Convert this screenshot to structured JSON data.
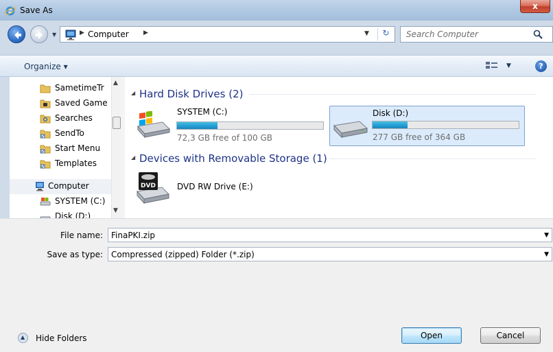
{
  "window": {
    "title": "Save As",
    "close_label": "x"
  },
  "address": {
    "path": "Computer",
    "search_placeholder": "Search Computer"
  },
  "toolbar": {
    "organize_label": "Organize ▾",
    "help_label": "?"
  },
  "nav_pane": {
    "items": [
      {
        "label": "SametimeTr",
        "icon": "folder-icon"
      },
      {
        "label": "Saved Game",
        "icon": "saved-games-icon"
      },
      {
        "label": "Searches",
        "icon": "searches-icon"
      },
      {
        "label": "SendTo",
        "icon": "shortcut-folder-icon"
      },
      {
        "label": "Start Menu",
        "icon": "shortcut-folder-icon"
      },
      {
        "label": "Templates",
        "icon": "shortcut-folder-icon"
      },
      {
        "label": "Computer",
        "icon": "computer-icon"
      },
      {
        "label": "SYSTEM (C:)",
        "icon": "drive-icon"
      },
      {
        "label": "Disk (D:)",
        "icon": "drive-icon"
      }
    ]
  },
  "main_pane": {
    "groups": [
      {
        "header": "Hard Disk Drives (2)",
        "drives": [
          {
            "name": "SYSTEM (C:)",
            "free_text": "72,3 GB free of 100 GB",
            "used_fraction": 0.277
          },
          {
            "name": "Disk (D:)",
            "free_text": "277 GB free of 364 GB",
            "used_fraction": 0.239
          }
        ]
      },
      {
        "header": "Devices with Removable Storage (1)",
        "drives": [
          {
            "name": "DVD RW Drive (E:)",
            "icon_text": "DVD"
          }
        ]
      }
    ]
  },
  "form": {
    "file_name_label": "File name:",
    "file_name_value": "FinaPKI.zip",
    "save_type_label": "Save as type:",
    "save_type_value": "Compressed (zipped) Folder (*.zip)"
  },
  "footer": {
    "hide_folders_label": "Hide Folders",
    "open_label": "Open",
    "cancel_label": "Cancel"
  },
  "colors": {
    "group_header": "#1e3287",
    "selection_bg": "#dcebfc",
    "progress_fill": "#26a0da"
  }
}
